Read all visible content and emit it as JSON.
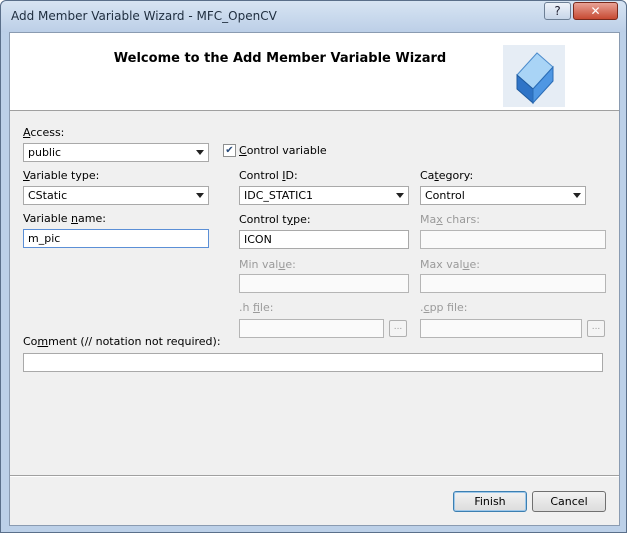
{
  "window": {
    "title": "Add Member Variable Wizard - MFC_OpenCV",
    "help_glyph": "?",
    "close_glyph": "✕"
  },
  "header": {
    "title": "Welcome to the Add Member Variable Wizard"
  },
  "form": {
    "access": {
      "label_u": "A",
      "label_rest": "ccess:",
      "value": "public"
    },
    "control_variable": {
      "label_u": "C",
      "label_rest": "ontrol variable",
      "checked": true
    },
    "variable_type": {
      "label_pre": "",
      "label_u": "V",
      "label_rest": "ariable type:",
      "value": "CStatic"
    },
    "control_id": {
      "label_pre": "Control ",
      "label_u": "I",
      "label_rest": "D:",
      "value": "IDC_STATIC1"
    },
    "category": {
      "label_pre": "Ca",
      "label_u": "t",
      "label_rest": "egory:",
      "value": "Control"
    },
    "variable_name": {
      "label_pre": "Variable ",
      "label_u": "n",
      "label_rest": "ame:",
      "value": "m_pic"
    },
    "control_type": {
      "label_pre": "Control t",
      "label_u": "y",
      "label_rest": "pe:",
      "value": "ICON"
    },
    "max_chars": {
      "label_pre": "Ma",
      "label_u": "x",
      "label_rest": " chars:",
      "value": ""
    },
    "min_value": {
      "label_pre": "Min val",
      "label_u": "u",
      "label_rest": "e:",
      "value": ""
    },
    "max_value": {
      "label_pre": "Max val",
      "label_u": "u",
      "label_rest": "e:",
      "value": ""
    },
    "h_file": {
      "label_pre": ".h ",
      "label_u": "f",
      "label_rest": "ile:",
      "value": "",
      "browse_label": "..."
    },
    "cpp_file": {
      "label_pre": ".",
      "label_u": "c",
      "label_rest": "pp file:",
      "value": "",
      "browse_label": "..."
    },
    "comment": {
      "label_pre": "Co",
      "label_u": "m",
      "label_rest": "ment (// notation not required):",
      "value": ""
    }
  },
  "buttons": {
    "finish": "Finish",
    "cancel": "Cancel"
  }
}
